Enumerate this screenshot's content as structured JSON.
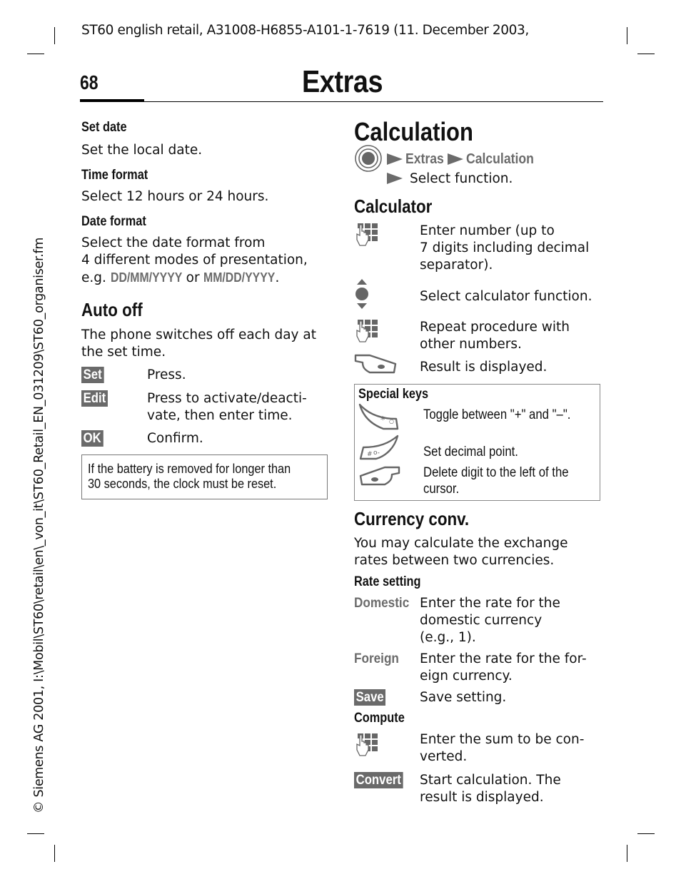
{
  "header": {
    "running_head": "ST60 english retail, A31008-H6855-A101-1-7619 (11. December 2003,",
    "page_number": "68",
    "chapter_title": "Extras"
  },
  "sidebar": {
    "path_text": "© Siemens AG 2001, I:\\Mobil\\ST60\\retail\\en\\_von_it\\ST60_Retail_EN_031209\\ST60_organiser.fm"
  },
  "left_column": {
    "set_date": {
      "heading": "Set date",
      "text": "Set the local date."
    },
    "time_format": {
      "heading": "Time format",
      "text": "Select 12 hours or 24 hours."
    },
    "date_format": {
      "heading": "Date format",
      "text_line1": "Select the date format from",
      "text_line2": "4 different modes of presentation,",
      "text_prefix": "e.g. ",
      "example1": "DD/MM/YYYY",
      "text_or": " or ",
      "example2": "MM/DD/YYYY",
      "text_suffix": "."
    },
    "auto_off": {
      "heading": "Auto off",
      "intro_line1": "The phone switches off each day at",
      "intro_line2": "the set time.",
      "steps": [
        {
          "key": "Set",
          "line1": "Press.",
          "line2": ""
        },
        {
          "key": "Edit",
          "line1": "Press to activate/deacti-",
          "line2": "vate, then enter time."
        },
        {
          "key": "OK",
          "line1": "Confirm.",
          "line2": ""
        }
      ],
      "note_line1": "If the battery is removed for longer than",
      "note_line2": "30 seconds, the clock must be reset."
    }
  },
  "right_column": {
    "calculation": {
      "heading": "Calculation",
      "menu_icon": "menu-key-icon",
      "path": [
        "Extras",
        "Calculation"
      ],
      "path_step": "Select function."
    },
    "calculator": {
      "heading": "Calculator",
      "steps": [
        {
          "icon": "keypad-icon",
          "lines": [
            "Enter number (up to",
            "7 digits including decimal",
            "separator)."
          ]
        },
        {
          "icon": "navigation-key-icon",
          "lines": [
            "Select calculator function."
          ]
        },
        {
          "icon": "keypad-icon",
          "lines": [
            "Repeat procedure with",
            "other numbers."
          ]
        },
        {
          "icon": "right-softkey-icon",
          "lines": [
            "Result is displayed."
          ]
        }
      ]
    },
    "special_keys": {
      "heading": "Special keys",
      "items": [
        {
          "icon": "star-key-icon",
          "lines": [
            "Toggle between \"+\" and \"–\"."
          ]
        },
        {
          "icon": "hash-key-icon",
          "lines": [
            "Set decimal point."
          ]
        },
        {
          "icon": "left-softkey-icon",
          "lines": [
            "Delete digit to the left of the",
            "cursor."
          ]
        }
      ]
    },
    "currency_conv": {
      "heading": "Currency conv.",
      "intro_line1": "You may calculate the exchange",
      "intro_line2": "rates between two currencies.",
      "rate_setting_heading": "Rate setting",
      "rate_rows": [
        {
          "label": "Domestic",
          "lines": [
            "Enter the rate for the",
            "domestic currency",
            "(e.g., 1)."
          ]
        },
        {
          "label": "Foreign",
          "lines": [
            "Enter the rate for the for-",
            "eign currency."
          ]
        }
      ],
      "save_key": "Save",
      "save_text": "Save setting.",
      "compute_heading": "Compute",
      "compute_rows": [
        {
          "icon": "keypad-icon",
          "lines": [
            "Enter the sum to be con-",
            "verted."
          ]
        }
      ],
      "convert_key": "Convert",
      "convert_lines": [
        "Start calculation. The",
        "result is displayed."
      ]
    }
  },
  "colors": {
    "softkey_bg": "#6a6a6a",
    "menu_path_text": "#6b6b6b",
    "box_border": "#888888"
  }
}
